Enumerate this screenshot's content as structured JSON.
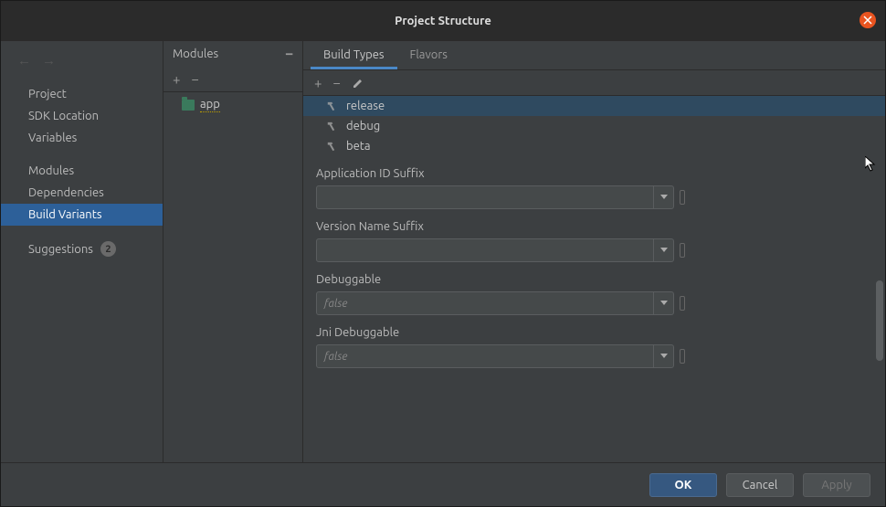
{
  "title": "Project Structure",
  "nav": {
    "group1": [
      "Project",
      "SDK Location",
      "Variables"
    ],
    "group2": [
      "Modules",
      "Dependencies",
      "Build Variants"
    ],
    "group3": [
      "Suggestions"
    ],
    "selected": "Build Variants",
    "suggestions_badge": "2"
  },
  "modules": {
    "header": "Modules",
    "items": [
      "app"
    ]
  },
  "tabs": {
    "items": [
      "Build Types",
      "Flavors"
    ],
    "active": "Build Types"
  },
  "variants": {
    "items": [
      "release",
      "debug",
      "beta"
    ],
    "selected": "release"
  },
  "form": {
    "fields": [
      {
        "label": "Application ID Suffix",
        "value": "",
        "placeholder": ""
      },
      {
        "label": "Version Name Suffix",
        "value": "",
        "placeholder": ""
      },
      {
        "label": "Debuggable",
        "value": "",
        "placeholder": "false"
      },
      {
        "label": "Jni Debuggable",
        "value": "",
        "placeholder": "false"
      }
    ]
  },
  "footer": {
    "ok": "OK",
    "cancel": "Cancel",
    "apply": "Apply"
  }
}
